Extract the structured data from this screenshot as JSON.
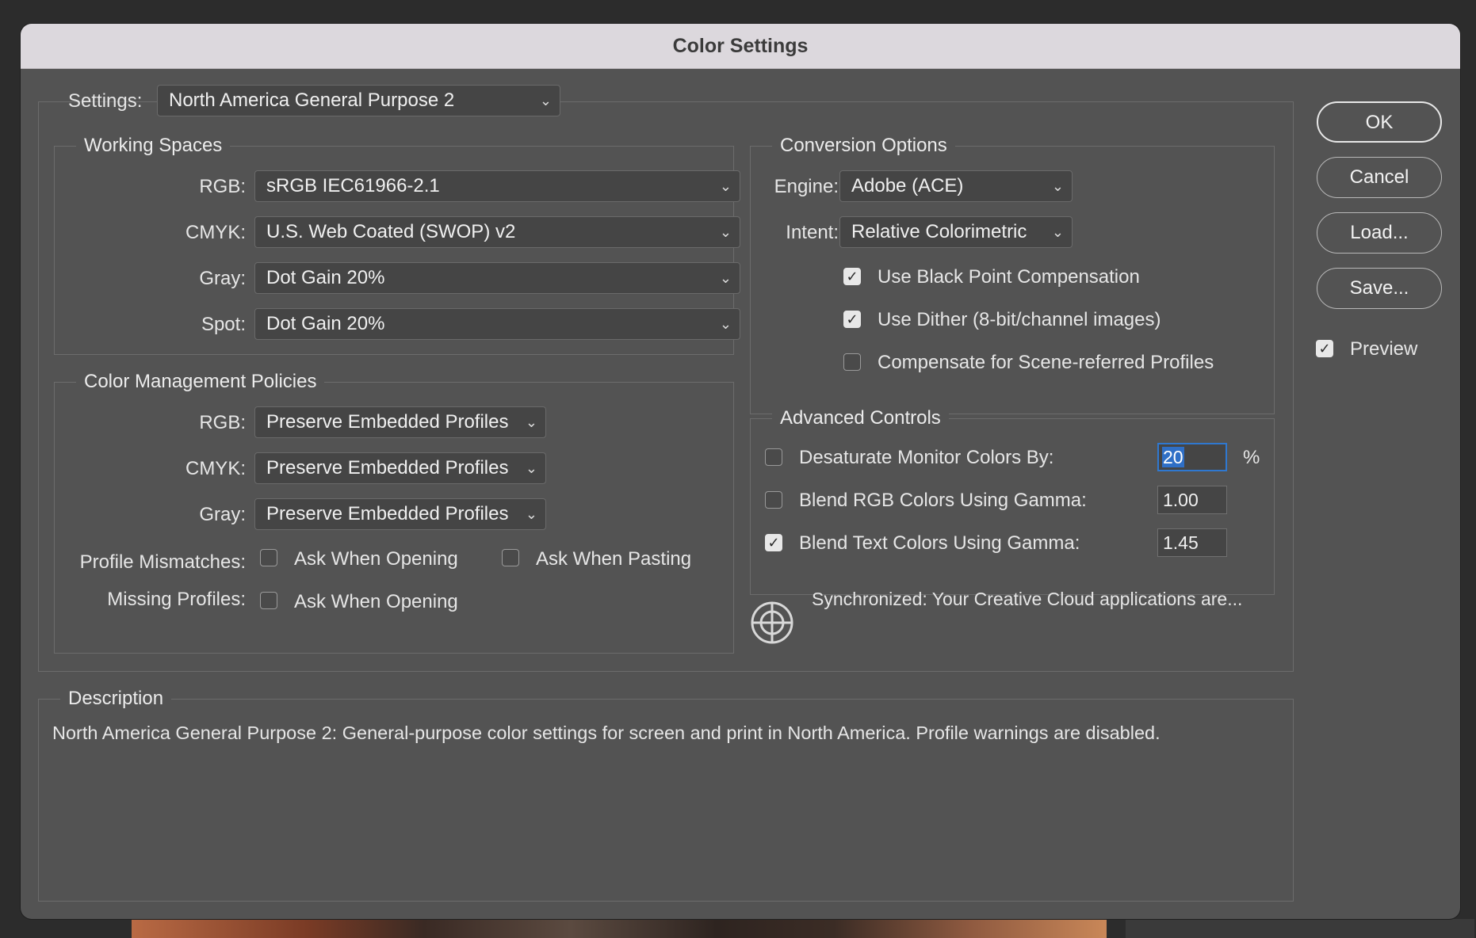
{
  "window": {
    "title": "Color Settings"
  },
  "settings": {
    "label": "Settings:",
    "value": "North America General Purpose 2"
  },
  "working_spaces": {
    "title": "Working Spaces",
    "rows": [
      {
        "label": "RGB:",
        "value": "sRGB IEC61966-2.1"
      },
      {
        "label": "CMYK:",
        "value": "U.S. Web Coated (SWOP) v2"
      },
      {
        "label": "Gray:",
        "value": "Dot Gain 20%"
      },
      {
        "label": "Spot:",
        "value": "Dot Gain 20%"
      }
    ]
  },
  "policies": {
    "title": "Color Management Policies",
    "rows": [
      {
        "label": "RGB:",
        "value": "Preserve Embedded Profiles"
      },
      {
        "label": "CMYK:",
        "value": "Preserve Embedded Profiles"
      },
      {
        "label": "Gray:",
        "value": "Preserve Embedded Profiles"
      }
    ],
    "profile_mismatches": {
      "label": "Profile Mismatches:",
      "ask_opening": "Ask When Opening",
      "ask_pasting": "Ask When Pasting",
      "ask_opening_checked": false,
      "ask_pasting_checked": false
    },
    "missing_profiles": {
      "label": "Missing Profiles:",
      "ask_opening": "Ask When Opening",
      "ask_opening_checked": false
    }
  },
  "conversion": {
    "title": "Conversion Options",
    "engine_label": "Engine:",
    "engine_value": "Adobe (ACE)",
    "intent_label": "Intent:",
    "intent_value": "Relative Colorimetric",
    "black_point": {
      "label": "Use Black Point Compensation",
      "checked": true
    },
    "dither": {
      "label": "Use Dither (8-bit/channel images)",
      "checked": true
    },
    "scene_referred": {
      "label": "Compensate for Scene-referred Profiles",
      "checked": false
    }
  },
  "advanced": {
    "title": "Advanced Controls",
    "desaturate": {
      "label": "Desaturate Monitor Colors By:",
      "value": "20",
      "unit": "%",
      "checked": false
    },
    "blend_rgb": {
      "label": "Blend RGB Colors Using Gamma:",
      "value": "1.00",
      "checked": false
    },
    "blend_text": {
      "label": "Blend Text Colors Using Gamma:",
      "value": "1.45",
      "checked": true
    }
  },
  "sync": {
    "text": "Synchronized: Your Creative Cloud applications are..."
  },
  "description": {
    "title": "Description",
    "text": "North America General Purpose 2:  General-purpose color settings for screen and print in North America. Profile warnings are disabled."
  },
  "buttons": {
    "ok": "OK",
    "cancel": "Cancel",
    "load": "Load...",
    "save": "Save..."
  },
  "preview": {
    "label": "Preview",
    "checked": true
  },
  "colors": {
    "dialog_bg": "#535353",
    "title_bar": "#dcd8dd",
    "focus": "#2f78d0"
  },
  "icons": {
    "chevron": "chevron-down-icon",
    "check": "checkmark-icon",
    "sync": "crosshair-sync-icon"
  }
}
